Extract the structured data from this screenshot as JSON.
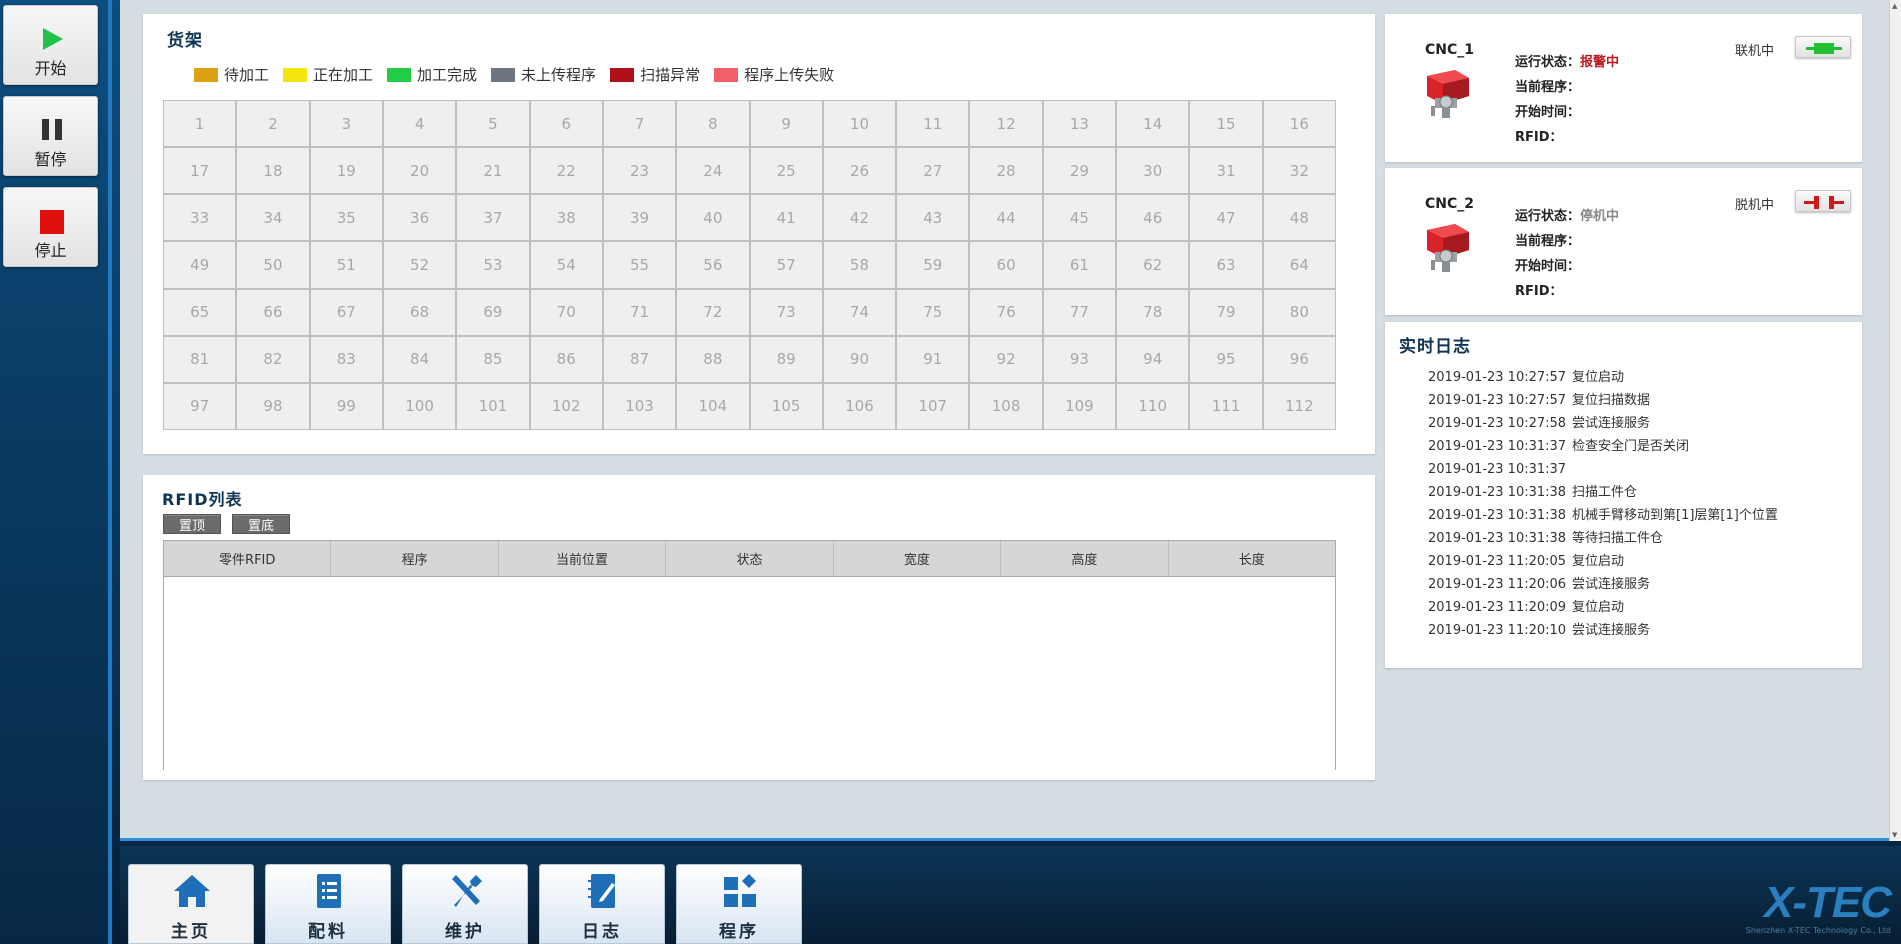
{
  "controls": {
    "start_label": "开始",
    "pause_label": "暂停",
    "stop_label": "停止"
  },
  "shelf": {
    "title": "货架",
    "legend": [
      {
        "label": "待加工",
        "color": "#dba312"
      },
      {
        "label": "正在加工",
        "color": "#f3e60c"
      },
      {
        "label": "加工完成",
        "color": "#22cc44"
      },
      {
        "label": "未上传程序",
        "color": "#6d7580"
      },
      {
        "label": "扫描异常",
        "color": "#b0101a"
      },
      {
        "label": "程序上传失败",
        "color": "#f06068"
      }
    ],
    "cells": [
      "1",
      "2",
      "3",
      "4",
      "5",
      "6",
      "7",
      "8",
      "9",
      "10",
      "11",
      "12",
      "13",
      "14",
      "15",
      "16",
      "17",
      "18",
      "19",
      "20",
      "21",
      "22",
      "23",
      "24",
      "25",
      "26",
      "27",
      "28",
      "29",
      "30",
      "31",
      "32",
      "33",
      "34",
      "35",
      "36",
      "37",
      "38",
      "39",
      "40",
      "41",
      "42",
      "43",
      "44",
      "45",
      "46",
      "47",
      "48",
      "49",
      "50",
      "51",
      "52",
      "53",
      "54",
      "55",
      "56",
      "57",
      "58",
      "59",
      "60",
      "61",
      "62",
      "63",
      "64",
      "65",
      "66",
      "67",
      "68",
      "69",
      "70",
      "71",
      "72",
      "73",
      "74",
      "75",
      "76",
      "77",
      "78",
      "79",
      "80",
      "81",
      "82",
      "83",
      "84",
      "85",
      "86",
      "87",
      "88",
      "89",
      "90",
      "91",
      "92",
      "93",
      "94",
      "95",
      "96",
      "97",
      "98",
      "99",
      "100",
      "101",
      "102",
      "103",
      "104",
      "105",
      "106",
      "107",
      "108",
      "109",
      "110",
      "111",
      "112"
    ]
  },
  "rfid": {
    "title": "RFID列表",
    "top_button": "置顶",
    "bottom_button": "置底",
    "columns": [
      "零件RFID",
      "程序",
      "当前位置",
      "状态",
      "宽度",
      "高度",
      "长度"
    ]
  },
  "cnc": [
    {
      "name": "CNC_1",
      "status_label": "运行状态：",
      "status_value": "报警中",
      "program_label": "当前程序：",
      "start_label": "开始时间：",
      "rfid_label": "RFID：",
      "connection": "联机中"
    },
    {
      "name": "CNC_2",
      "status_label": "运行状态：",
      "status_value": "停机中",
      "program_label": "当前程序：",
      "start_label": "开始时间：",
      "rfid_label": "RFID：",
      "connection": "脱机中"
    }
  ],
  "log": {
    "title": "实时日志",
    "entries": [
      {
        "time": "2019-01-23 10:27:57",
        "msg": "复位启动"
      },
      {
        "time": "2019-01-23 10:27:57",
        "msg": "复位扫描数据"
      },
      {
        "time": "2019-01-23 10:27:58",
        "msg": "尝试连接服务"
      },
      {
        "time": "2019-01-23 10:31:37",
        "msg": "检查安全门是否关闭"
      },
      {
        "time": "2019-01-23 10:31:37",
        "msg": ""
      },
      {
        "time": "2019-01-23 10:31:38",
        "msg": "扫描工件仓"
      },
      {
        "time": "2019-01-23 10:31:38",
        "msg": "机械手臂移动到第[1]层第[1]个位置"
      },
      {
        "time": "2019-01-23 10:31:38",
        "msg": "等待扫描工件仓"
      },
      {
        "time": "2019-01-23 11:20:05",
        "msg": "复位启动"
      },
      {
        "time": "2019-01-23 11:20:06",
        "msg": "尝试连接服务"
      },
      {
        "time": "2019-01-23 11:20:09",
        "msg": "复位启动"
      },
      {
        "time": "2019-01-23 11:20:10",
        "msg": "尝试连接服务"
      }
    ]
  },
  "nav": [
    {
      "label": "主页",
      "icon": "home-icon"
    },
    {
      "label": "配料",
      "icon": "list-icon"
    },
    {
      "label": "维护",
      "icon": "tools-icon"
    },
    {
      "label": "日志",
      "icon": "log-icon"
    },
    {
      "label": "程序",
      "icon": "program-icon"
    }
  ],
  "brand": {
    "logo": "X-TEC",
    "sub": "Shenzhen X-TEC Technology Co., Ltd"
  }
}
